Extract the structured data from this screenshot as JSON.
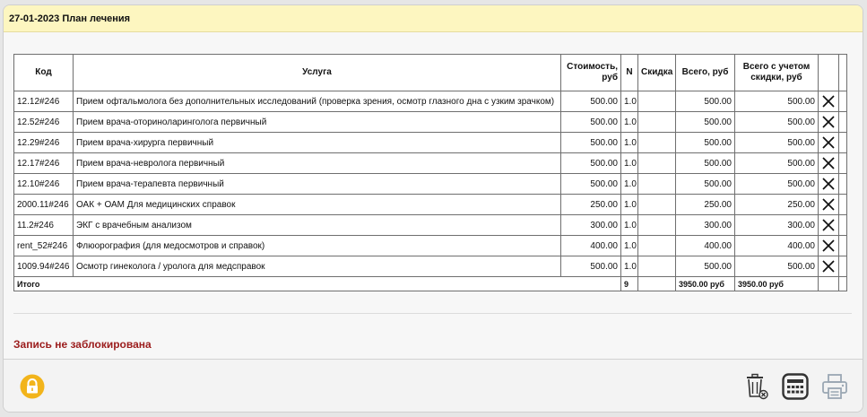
{
  "header": {
    "title": "27-01-2023 План лечения"
  },
  "table": {
    "columns": {
      "code": "Код",
      "service": "Услуга",
      "cost": "Стоимость, руб",
      "n": "N",
      "discount": "Скидка",
      "total": "Всего, руб",
      "total_disc": "Всего с учетом скидки, руб"
    },
    "rows": [
      {
        "code": "12.12#246",
        "service": "Прием офтальмолога без дополнительных исследований (проверка зрения, осмотр глазного дна с узким зрачком)",
        "cost": "500.00",
        "n": "1.0",
        "discount": "",
        "total": "500.00",
        "total_disc": "500.00"
      },
      {
        "code": "12.52#246",
        "service": "Прием врача-оториноларинголога первичный",
        "cost": "500.00",
        "n": "1.0",
        "discount": "",
        "total": "500.00",
        "total_disc": "500.00"
      },
      {
        "code": "12.29#246",
        "service": "Прием врача-хирурга  первичный",
        "cost": "500.00",
        "n": "1.0",
        "discount": "",
        "total": "500.00",
        "total_disc": "500.00"
      },
      {
        "code": "12.17#246",
        "service": "Прием врача-невролога первичный",
        "cost": "500.00",
        "n": "1.0",
        "discount": "",
        "total": "500.00",
        "total_disc": "500.00"
      },
      {
        "code": "12.10#246",
        "service": "Прием врача-терапевта первичный",
        "cost": "500.00",
        "n": "1.0",
        "discount": "",
        "total": "500.00",
        "total_disc": "500.00"
      },
      {
        "code": "2000.11#246",
        "service": "ОАК + ОАМ Для медицинских справок",
        "cost": "250.00",
        "n": "1.0",
        "discount": "",
        "total": "250.00",
        "total_disc": "250.00"
      },
      {
        "code": "11.2#246",
        "service": "ЭКГ с врачебным анализом",
        "cost": "300.00",
        "n": "1.0",
        "discount": "",
        "total": "300.00",
        "total_disc": "300.00"
      },
      {
        "code": "rent_52#246",
        "service": "Флюорография (для медосмотров и справок)",
        "cost": "400.00",
        "n": "1.0",
        "discount": "",
        "total": "400.00",
        "total_disc": "400.00"
      },
      {
        "code": "1009.94#246",
        "service": "Осмотр гинеколога / уролога для медсправок",
        "cost": "500.00",
        "n": "1.0",
        "discount": "",
        "total": "500.00",
        "total_disc": "500.00"
      }
    ],
    "totals": {
      "label": "Итого",
      "n": "9",
      "total": "3950.00 руб",
      "total_disc": "3950.00 руб"
    }
  },
  "status": {
    "text": "Запись не заблокирована",
    "color": "#9b1c1c"
  },
  "footer": {
    "icons": [
      "lock-icon",
      "trash-bin-icon",
      "calculator-icon",
      "printer-icon"
    ],
    "lock_color": "#f2b41b"
  }
}
